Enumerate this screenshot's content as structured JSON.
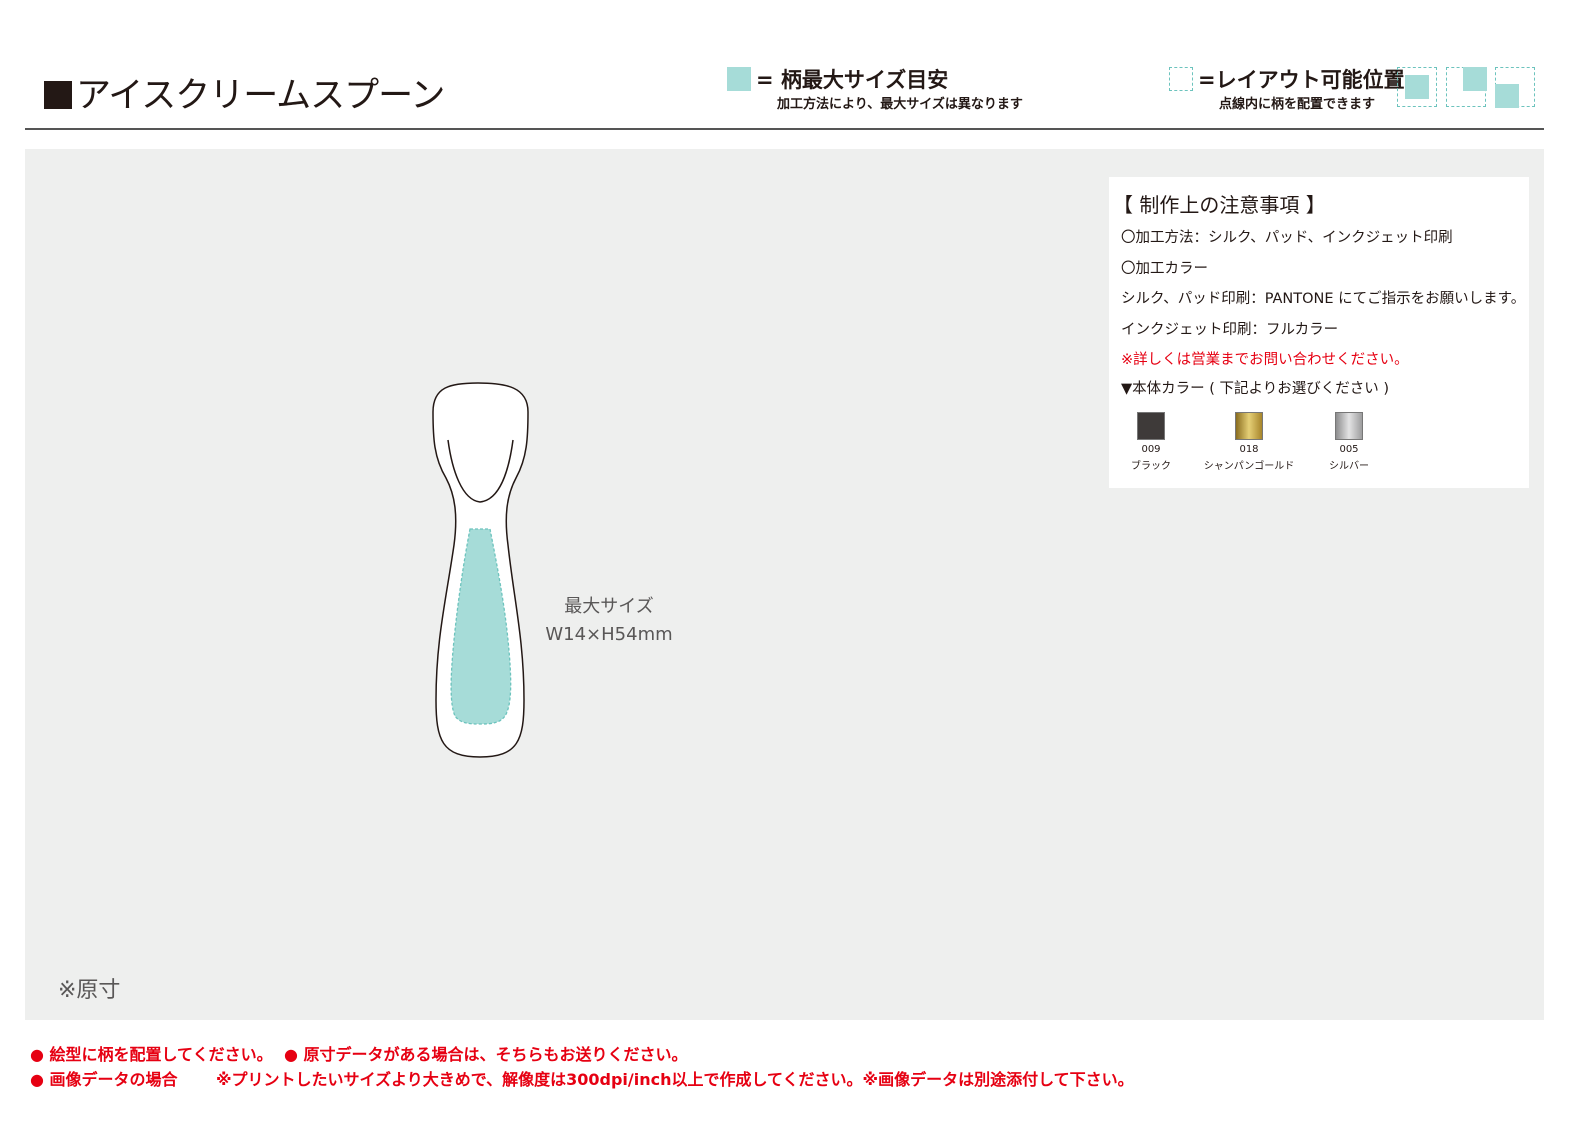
{
  "header": {
    "title_mark": "■",
    "title": "アイスクリームスプーン",
    "legend_max": {
      "title": "= 柄最大サイズ目安",
      "note": "加工方法により、最大サイズは異なります",
      "color": "#a6dcd8"
    },
    "legend_layout": {
      "title": "=レイアウト可能位置",
      "note": "点線内に柄を配置できます",
      "color": "#6cc3bd"
    }
  },
  "notes": {
    "heading": "【 制作上の注意事項 】",
    "lines": [
      "〇加工方法：シルク、パッド、インクジェット印刷",
      "〇加工カラー",
      "シルク、パッド印刷：PANTONE にてご指示をお願いします。",
      "インクジェット印刷：フルカラー"
    ],
    "warning": "※詳しくは営業までお問い合わせください。",
    "colors_heading": "▼本体カラー ( 下記よりお選びください )",
    "swatches": [
      {
        "code": "009",
        "name": "ブラック",
        "color": "#3e3a39"
      },
      {
        "code": "018",
        "name": "シャンパンゴールド",
        "color": "#b59a3c"
      },
      {
        "code": "005",
        "name": "シルバー",
        "color": "#b5b5b6"
      }
    ]
  },
  "figure": {
    "max_label": "最大サイズ",
    "max_size": "W14×H54mm",
    "print_area_color": "#a6dcd8"
  },
  "original_size_note": "※原寸",
  "footer": {
    "line1_a": "● 絵型に柄を配置してください。",
    "line1_b": "● 原寸データがある場合は、そちらもお送りください。",
    "line2_a": "● 画像データの場合",
    "line2_b": "※プリントしたいサイズより大きめで、解像度は300dpi/inch以上で作成してください。※画像データは別途添付して下さい。"
  }
}
